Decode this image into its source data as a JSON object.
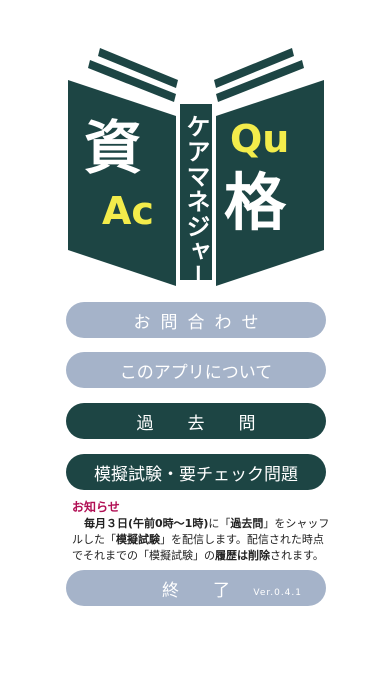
{
  "logo": {
    "vertical_title": "ケアマネジャー",
    "char_left": "資",
    "char_right": "格",
    "ac": "Ac",
    "qu": "Qu",
    "colors": {
      "book": "#1d4544",
      "accent": "#f3ec4b",
      "white": "#ffffff"
    }
  },
  "menu": {
    "contact": "お問合わせ",
    "about": "このアプリについて",
    "past": "過去問",
    "mock": "模擬試験・要チェック問題",
    "end": "終了"
  },
  "notice": {
    "title": "お知らせ",
    "p1": "毎月３日(午前0時〜1時)",
    "p2": "に「",
    "p3": "過去問",
    "p4": "」をシャッフルした「",
    "p5": "模擬試験",
    "p6": "」を配信します。配信された時点でそれまでの「模擬試験」の",
    "p7": "履歴は削除",
    "p8": "されます。"
  },
  "version": "Ver.0.4.1"
}
